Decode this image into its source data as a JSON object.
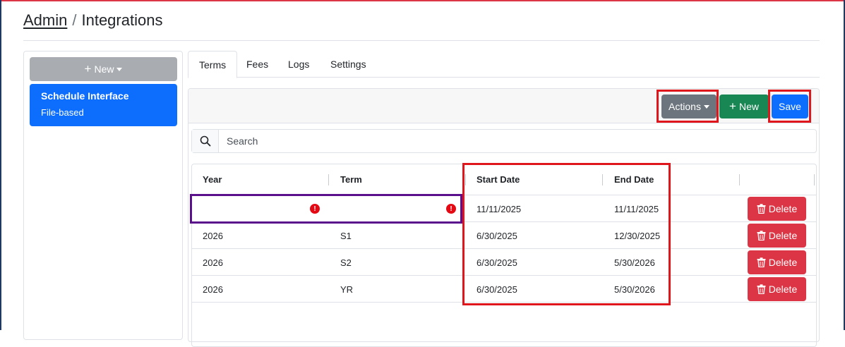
{
  "breadcrumb": {
    "parent": "Admin",
    "separator": "/",
    "current": "Integrations"
  },
  "sidebar": {
    "new_label": "New",
    "items": [
      {
        "title": "Schedule Interface",
        "subtitle": "File-based"
      }
    ]
  },
  "tabs": [
    {
      "label": "Terms",
      "active": true
    },
    {
      "label": "Fees",
      "active": false
    },
    {
      "label": "Logs",
      "active": false
    },
    {
      "label": "Settings",
      "active": false
    }
  ],
  "toolbar": {
    "actions_label": "Actions",
    "new_label": "New",
    "save_label": "Save"
  },
  "search": {
    "placeholder": "Search",
    "value": ""
  },
  "table": {
    "columns": [
      "Year",
      "Term",
      "Start Date",
      "End Date",
      ""
    ],
    "rows": [
      {
        "year": "",
        "term": "",
        "start": "11/11/2025",
        "end": "11/11/2025",
        "year_error": true,
        "term_error": true
      },
      {
        "year": "2026",
        "term": "S1",
        "start": "6/30/2025",
        "end": "12/30/2025"
      },
      {
        "year": "2026",
        "term": "S2",
        "start": "6/30/2025",
        "end": "5/30/2026"
      },
      {
        "year": "2026",
        "term": "YR",
        "start": "6/30/2025",
        "end": "5/30/2026"
      }
    ],
    "delete_label": "Delete",
    "error_glyph": "!"
  },
  "colors": {
    "primary": "#0d6efd",
    "success": "#198754",
    "secondary": "#6c757d",
    "danger": "#dc3545",
    "highlight_red": "#e0161d",
    "highlight_purple": "#5a0f8c"
  },
  "icons": {
    "plus": "plus-icon",
    "caret": "caret-down-icon",
    "search": "search-icon",
    "trash": "trash-icon",
    "error": "error-icon"
  }
}
